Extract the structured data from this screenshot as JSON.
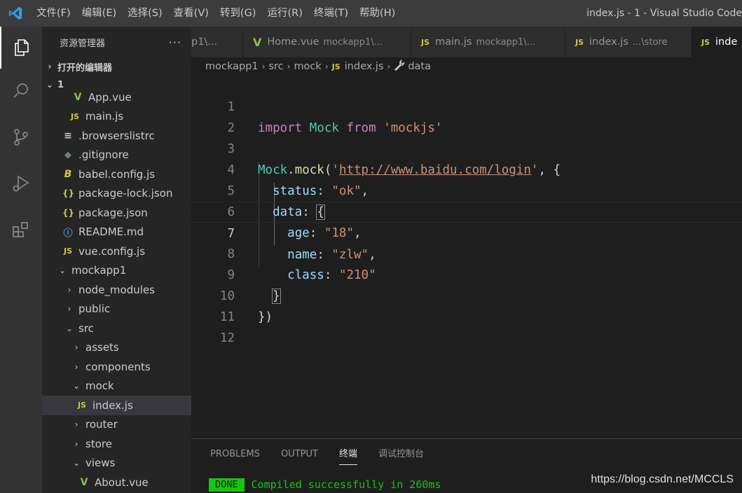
{
  "titlebar": {
    "menu": [
      "文件(F)",
      "编辑(E)",
      "选择(S)",
      "查看(V)",
      "转到(G)",
      "运行(R)",
      "终端(T)",
      "帮助(H)"
    ],
    "window_title": "index.js - 1 - Visual Studio Code"
  },
  "activitybar": {
    "icons": [
      "explorer-icon",
      "search-icon",
      "source-control-icon",
      "run-debug-icon",
      "extensions-icon"
    ]
  },
  "sidebar": {
    "title": "资源管理器",
    "more": "···",
    "open_editors": "打开的编辑器",
    "folder": "1",
    "items": [
      {
        "label": "App.vue"
      },
      {
        "label": "main.js"
      },
      {
        "label": ".browserslistrc"
      },
      {
        "label": ".gitignore"
      },
      {
        "label": "babel.config.js"
      },
      {
        "label": "package-lock.json"
      },
      {
        "label": "package.json"
      },
      {
        "label": "README.md"
      },
      {
        "label": "vue.config.js"
      },
      {
        "label": "mockapp1"
      },
      {
        "label": "node_modules"
      },
      {
        "label": "public"
      },
      {
        "label": "src"
      },
      {
        "label": "assets"
      },
      {
        "label": "components"
      },
      {
        "label": "mock"
      },
      {
        "label": "index.js"
      },
      {
        "label": "router"
      },
      {
        "label": "store"
      },
      {
        "label": "views"
      },
      {
        "label": "About.vue"
      }
    ]
  },
  "tabs": [
    {
      "label": "p1\\...",
      "desc": ""
    },
    {
      "label": "Home.vue",
      "desc": "mockapp1\\..."
    },
    {
      "label": "main.js",
      "desc": "mockapp1\\..."
    },
    {
      "label": "index.js",
      "desc": "...\\store"
    },
    {
      "label": "inde",
      "desc": ""
    }
  ],
  "breadcrumb": [
    "mockapp1",
    "src",
    "mock",
    "index.js",
    "data"
  ],
  "editor": {
    "line_numbers": [
      "1",
      "2",
      "3",
      "4",
      "5",
      "6",
      "7",
      "8",
      "9",
      "10",
      "11",
      "12"
    ],
    "current_line": 7,
    "code": {
      "l1_import": "import",
      "l1_mock": "Mock",
      "l1_from": "from",
      "l1_str": "'mockjs'",
      "l3_mock": "Mock",
      "l3_dot": ".",
      "l3_fn": "mock",
      "l3_open": "(",
      "l3_q1": "'",
      "l3_url": "http://www.baidu.com/login",
      "l3_q2": "'",
      "l3_rest": ", {",
      "l4_key": "status",
      "l4_colon": ": ",
      "l4_val": "\"ok\"",
      "l4_comma": ",",
      "l5_key": "data",
      "l5_colon": ": ",
      "l5_brace": "{",
      "l6_key": "age",
      "l6_colon": ": ",
      "l6_val": "\"18\"",
      "l6_comma": ",",
      "l7_key": "name",
      "l7_colon": ": ",
      "l7_val": "\"zlw\"",
      "l7_comma": ",",
      "l8_key": "class",
      "l8_colon": ": ",
      "l8_val": "\"210\"",
      "l9_brace": "}",
      "l10_close": "})"
    }
  },
  "panel": {
    "tabs": [
      "PROBLEMS",
      "OUTPUT",
      "终端",
      "调试控制台"
    ],
    "active_tab": "终端",
    "badge": "DONE",
    "message": "Compiled successfully in 260ms"
  },
  "watermark": "https://blog.csdn.net/MCCLS",
  "colors": {
    "accent": "#007acc",
    "keyword": "#c586c0",
    "string": "#ce9178",
    "property": "#9cdcfe",
    "type": "#4ec9b0",
    "function": "#dcdcaa",
    "success": "#16c60c",
    "js_icon": "#cbcb41",
    "vue_icon": "#8dc149"
  }
}
